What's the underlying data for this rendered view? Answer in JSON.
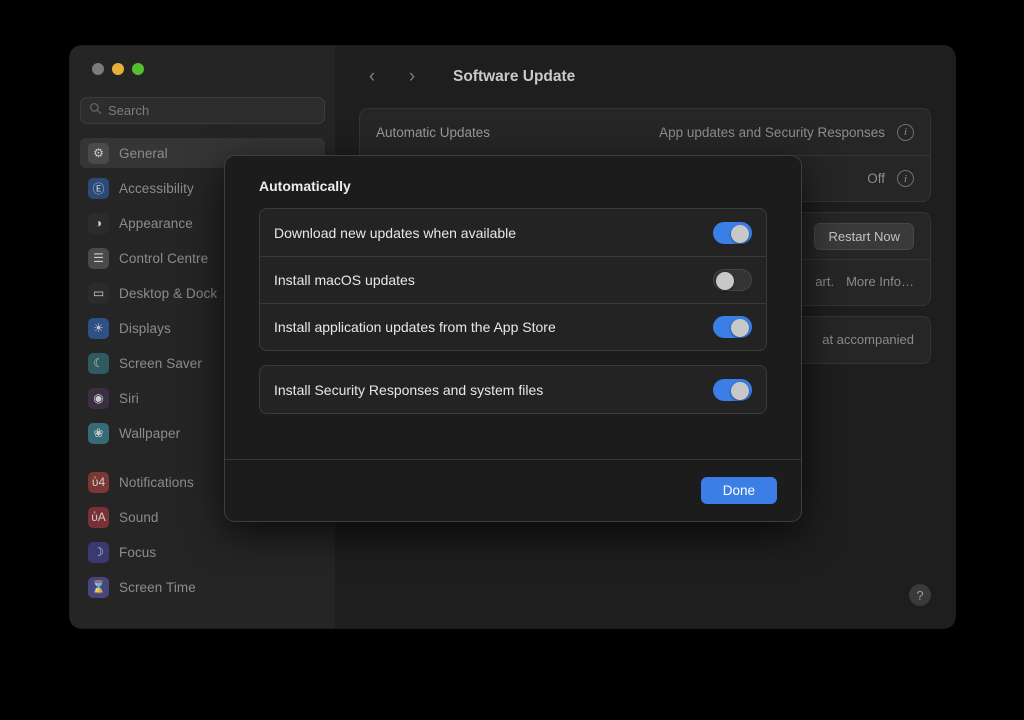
{
  "window": {
    "traffic_lights": [
      {
        "name": "close",
        "color": "#7b7b7b"
      },
      {
        "name": "minimize",
        "color": "#e7b13c"
      },
      {
        "name": "maximize",
        "color": "#54c02d"
      }
    ]
  },
  "sidebar": {
    "search": {
      "value": "",
      "placeholder": "Search"
    },
    "items": [
      {
        "label": "General",
        "icon": "gear-icon",
        "selected": true,
        "bg": "#4a4a4a",
        "glyph": "⚙"
      },
      {
        "label": "Accessibility",
        "icon": "accessibility-icon",
        "selected": false,
        "bg": "#2b4a78",
        "glyph": "Ⓔ"
      },
      {
        "label": "Appearance",
        "icon": "appearance-icon",
        "selected": false,
        "bg": "#2b2b2b",
        "glyph": "◑"
      },
      {
        "label": "Control Centre",
        "icon": "control-centre-icon",
        "selected": false,
        "bg": "#4a4a4a",
        "glyph": "☰"
      },
      {
        "label": "Desktop & Dock",
        "icon": "desktop-dock-icon",
        "selected": false,
        "bg": "#2b2b2b",
        "glyph": "▭"
      },
      {
        "label": "Displays",
        "icon": "displays-icon",
        "selected": false,
        "bg": "#2f5085",
        "glyph": "☀"
      },
      {
        "label": "Screen Saver",
        "icon": "screen-saver-icon",
        "selected": false,
        "bg": "#2f5a60",
        "glyph": "☾"
      },
      {
        "label": "Siri",
        "icon": "siri-icon",
        "selected": false,
        "bg": "#3a2e40",
        "glyph": "◉"
      },
      {
        "label": "Wallpaper",
        "icon": "wallpaper-icon",
        "selected": false,
        "bg": "#356a77",
        "glyph": "❀"
      },
      {
        "label": "__GAP__",
        "icon": "",
        "selected": false,
        "bg": "",
        "glyph": ""
      },
      {
        "label": "Notifications",
        "icon": "notifications-icon",
        "selected": false,
        "bg": "#7a3733",
        "glyph": "ὑ4"
      },
      {
        "label": "Sound",
        "icon": "sound-icon",
        "selected": false,
        "bg": "#7a3036",
        "glyph": "ὐA"
      },
      {
        "label": "Focus",
        "icon": "focus-icon",
        "selected": false,
        "bg": "#3a3a72",
        "glyph": "☽"
      },
      {
        "label": "Screen Time",
        "icon": "screen-time-icon",
        "selected": false,
        "bg": "#46467e",
        "glyph": "⌛"
      }
    ]
  },
  "detail": {
    "back_icon": "chevron-left-icon",
    "forward_icon": "chevron-right-icon",
    "title": "Software Update",
    "rows": [
      {
        "label": "Automatic Updates",
        "value": "App updates and Security Responses",
        "info_icon": "info-icon"
      },
      {
        "value": "Off",
        "info_icon": "info-icon"
      }
    ],
    "restart_button": "Restart Now",
    "restart_note_tail": "art.",
    "more_info_link": "More Info…",
    "accompanied_text": "at accompanied",
    "help_icon": "?"
  },
  "sheet": {
    "title": "Automatically",
    "groups": [
      {
        "rows": [
          {
            "label": "Download new updates when available",
            "toggle": "on",
            "toggle_name": "download-updates-toggle"
          },
          {
            "label": "Install macOS updates",
            "toggle": "off",
            "toggle_name": "install-macos-updates-toggle"
          },
          {
            "label": "Install application updates from the App Store",
            "toggle": "on",
            "toggle_name": "install-app-store-updates-toggle"
          }
        ]
      },
      {
        "rows": [
          {
            "label": "Install Security Responses and system files",
            "toggle": "on",
            "toggle_name": "install-security-responses-toggle"
          }
        ]
      }
    ],
    "done_label": "Done"
  },
  "colors": {
    "accent": "#3b7ee5",
    "toggle_off": "#333333",
    "knob": "#c8c8c8",
    "link": "#3f7fd4",
    "window_bg": "#1e1e1e",
    "sidebar_bg": "#252525",
    "sheet_bg": "#1c1c1c"
  }
}
